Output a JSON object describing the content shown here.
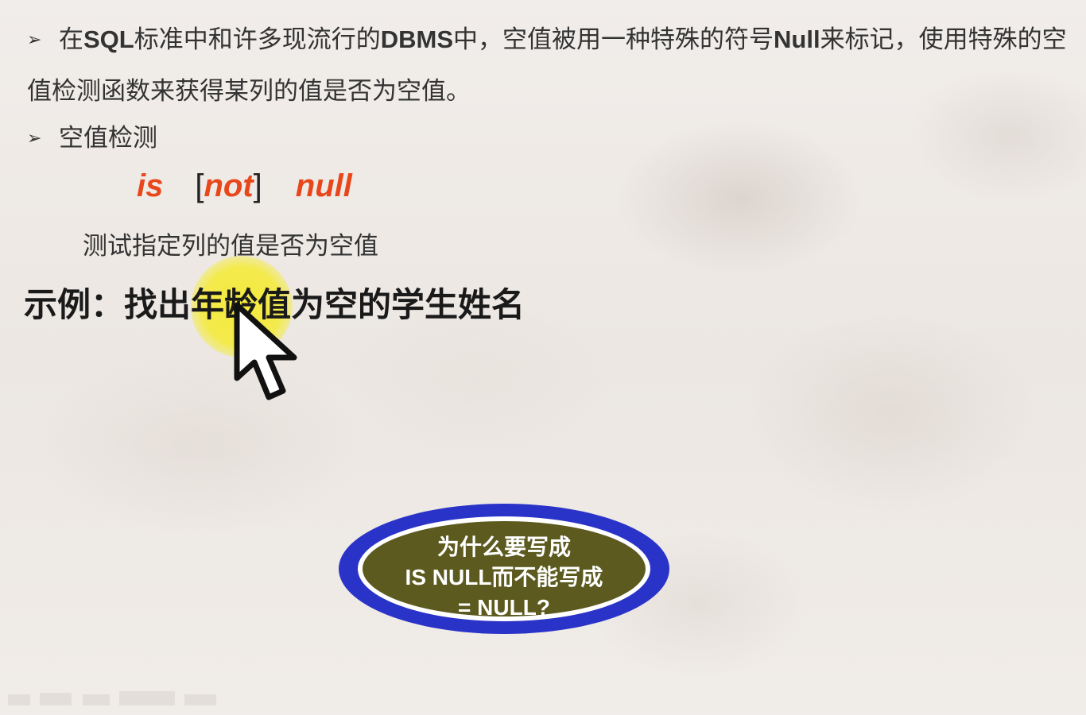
{
  "slide": {
    "bullet_marker": "➢",
    "bullet1": {
      "t1": "在",
      "t2": "SQL",
      "t3": "标准中和许多现流行的",
      "t4": "DBMS",
      "t5": "中，空值被用一种特殊的符号",
      "t6": "Null",
      "t7": "来标记，使用特殊的空值检测函数来获得某列的值是否为空值。"
    },
    "bullet2": "空值检测",
    "syntax": {
      "is": "is",
      "open_bracket": "[",
      "not": "not",
      "close_bracket": "]",
      "null": "null",
      "keyword_color": "#e8471b"
    },
    "syntax_desc": "测试指定列的值是否为空值",
    "example_title": "示例：找出年龄值为空的学生姓名",
    "question": {
      "line1": "为什么要写成",
      "line2": "IS NULL而不能写成",
      "line3": "= NULL?",
      "fill_color": "#5c5a1e",
      "ring_color": "#2a33c8"
    },
    "cursor_icon": "mouse-pointer-arrow",
    "highlight_color": "#f5eb28"
  }
}
